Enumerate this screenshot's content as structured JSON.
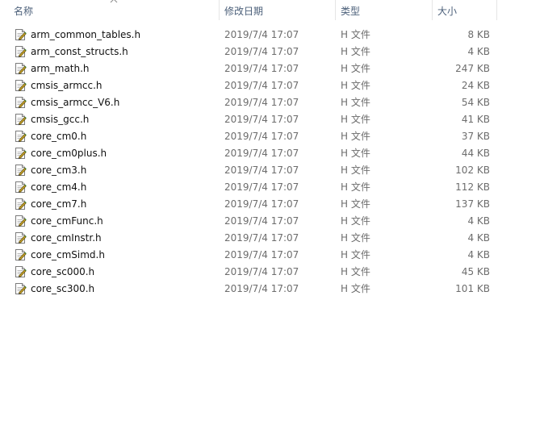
{
  "columns": {
    "name": "名称",
    "date": "修改日期",
    "type": "类型",
    "size": "大小"
  },
  "sort": {
    "column": "name",
    "direction": "ascending",
    "icon": "chevron-up-icon"
  },
  "file_icon": "header-file-icon",
  "files": [
    {
      "name": "arm_common_tables.h",
      "date": "2019/7/4 17:07",
      "type": "H 文件",
      "size": "8 KB"
    },
    {
      "name": "arm_const_structs.h",
      "date": "2019/7/4 17:07",
      "type": "H 文件",
      "size": "4 KB"
    },
    {
      "name": "arm_math.h",
      "date": "2019/7/4 17:07",
      "type": "H 文件",
      "size": "247 KB"
    },
    {
      "name": "cmsis_armcc.h",
      "date": "2019/7/4 17:07",
      "type": "H 文件",
      "size": "24 KB"
    },
    {
      "name": "cmsis_armcc_V6.h",
      "date": "2019/7/4 17:07",
      "type": "H 文件",
      "size": "54 KB"
    },
    {
      "name": "cmsis_gcc.h",
      "date": "2019/7/4 17:07",
      "type": "H 文件",
      "size": "41 KB"
    },
    {
      "name": "core_cm0.h",
      "date": "2019/7/4 17:07",
      "type": "H 文件",
      "size": "37 KB"
    },
    {
      "name": "core_cm0plus.h",
      "date": "2019/7/4 17:07",
      "type": "H 文件",
      "size": "44 KB"
    },
    {
      "name": "core_cm3.h",
      "date": "2019/7/4 17:07",
      "type": "H 文件",
      "size": "102 KB"
    },
    {
      "name": "core_cm4.h",
      "date": "2019/7/4 17:07",
      "type": "H 文件",
      "size": "112 KB"
    },
    {
      "name": "core_cm7.h",
      "date": "2019/7/4 17:07",
      "type": "H 文件",
      "size": "137 KB"
    },
    {
      "name": "core_cmFunc.h",
      "date": "2019/7/4 17:07",
      "type": "H 文件",
      "size": "4 KB"
    },
    {
      "name": "core_cmInstr.h",
      "date": "2019/7/4 17:07",
      "type": "H 文件",
      "size": "4 KB"
    },
    {
      "name": "core_cmSimd.h",
      "date": "2019/7/4 17:07",
      "type": "H 文件",
      "size": "4 KB"
    },
    {
      "name": "core_sc000.h",
      "date": "2019/7/4 17:07",
      "type": "H 文件",
      "size": "45 KB"
    },
    {
      "name": "core_sc300.h",
      "date": "2019/7/4 17:07",
      "type": "H 文件",
      "size": "101 KB"
    }
  ]
}
